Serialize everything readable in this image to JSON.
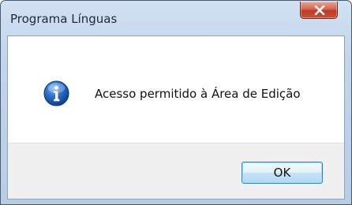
{
  "window": {
    "title": "Programa Línguas"
  },
  "dialog": {
    "icon": "info-icon",
    "message": "Acesso permitido à Área de Edição",
    "ok_label": "OK"
  },
  "colors": {
    "title_gradient_top": "#d2e1f2",
    "close_button_red": "#c7513b",
    "info_icon_blue": "#1f5fb8",
    "footer_gray": "#f0f0f0",
    "ok_button_border": "#3c7fb1"
  }
}
